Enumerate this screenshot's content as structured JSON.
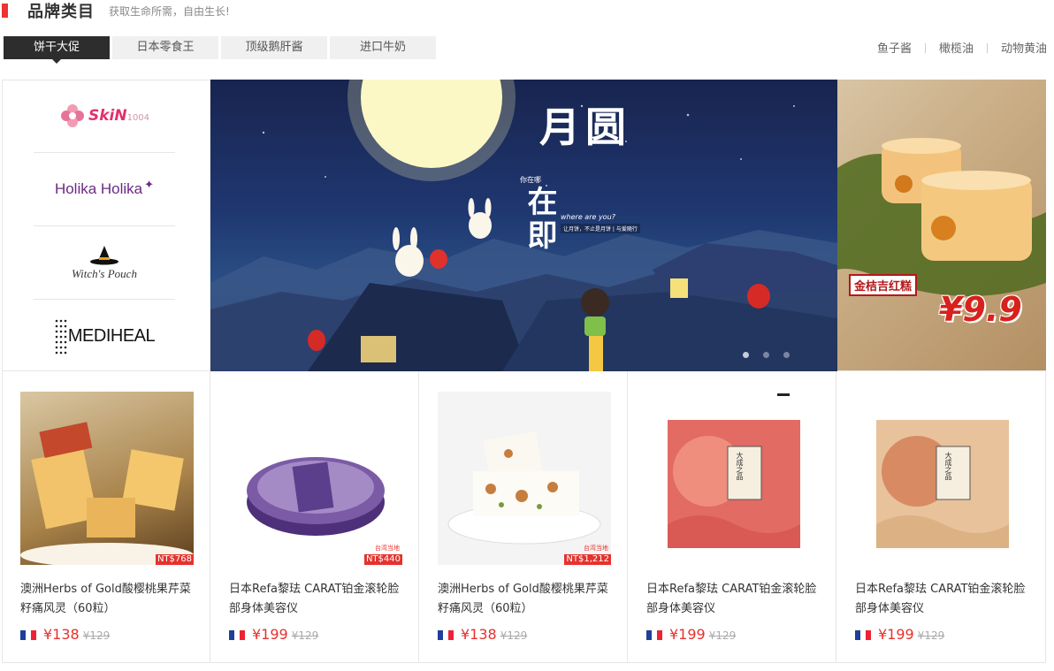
{
  "header": {
    "title": "品牌类目",
    "subtitle": "获取生命所需，自由生长!"
  },
  "tabs": [
    {
      "label": "饼干大促",
      "active": true
    },
    {
      "label": "日本零食王",
      "active": false
    },
    {
      "label": "顶级鹅肝酱",
      "active": false
    },
    {
      "label": "进口牛奶",
      "active": false
    }
  ],
  "right_links": [
    "鱼子酱",
    "橄榄油",
    "动物黄油"
  ],
  "brands": [
    {
      "name": "Skin1004",
      "main": "SkiN",
      "sub": "1004"
    },
    {
      "name": "Holika Holika",
      "main": "Holika Holika"
    },
    {
      "name": "Witch's Pouch",
      "main": "Witch's Pouch"
    },
    {
      "name": "MEDIHEAL",
      "main": "MEDIHEAL"
    }
  ],
  "banner": {
    "headline_1": "月圆",
    "headline_2": "在即",
    "tagline": "where are you?",
    "vertical_small": "你在哪",
    "caption": "让月饼，不止是月饼 | 与爱随行",
    "slide_count": 3,
    "active_slide": 1
  },
  "promo": {
    "label": "金桔吉红糕",
    "price": "¥9.9"
  },
  "products": [
    {
      "name": "澳洲Herbs of Gold酸樱桃果芹菜籽痛风灵（60粒）",
      "price": "¥138",
      "old_price": "¥129",
      "tag": "NT$768",
      "note": "",
      "origin": "france"
    },
    {
      "name": "日本Refa黎珐 CARAT铂金滚轮脸部身体美容仪",
      "price": "¥199",
      "old_price": "¥129",
      "tag": "NT$440",
      "note": "台湾当地",
      "origin": "france"
    },
    {
      "name": "澳洲Herbs of Gold酸樱桃果芹菜籽痛风灵（60粒）",
      "price": "¥138",
      "old_price": "¥129",
      "tag": "NT$1,212",
      "note": "台湾当地",
      "origin": "france"
    },
    {
      "name": "日本Refa黎珐 CARAT铂金滚轮脸部身体美容仪",
      "price": "¥199",
      "old_price": "¥129",
      "tag": "",
      "note": "",
      "origin": "france",
      "box_text": "大成之品"
    },
    {
      "name": "日本Refa黎珐 CARAT铂金滚轮脸部身体美容仪",
      "price": "¥199",
      "old_price": "¥129",
      "tag": "",
      "note": "",
      "origin": "france",
      "box_text": "大成之品"
    }
  ],
  "colors": {
    "accent": "#e5322d",
    "tab_active": "#2d2d2d",
    "tab_inactive": "#f0f0f0"
  }
}
